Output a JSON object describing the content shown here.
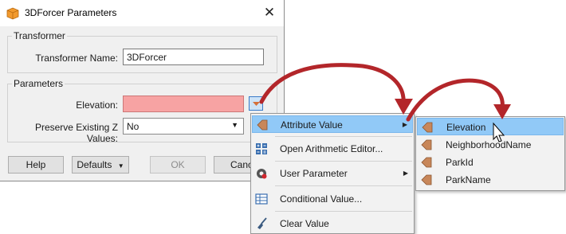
{
  "dialog": {
    "title": "3DForcer Parameters",
    "close_glyph": "✕",
    "transformer_group": {
      "label": "Transformer",
      "name_label": "Transformer Name:",
      "name_value": "3DForcer"
    },
    "parameters_group": {
      "label": "Parameters",
      "elevation_label": "Elevation:",
      "elevation_value": "",
      "preserve_label": "Preserve Existing Z Values:",
      "preserve_value": "No"
    },
    "buttons": {
      "help": "Help",
      "defaults": "Defaults",
      "ok": "OK",
      "cancel": "Cancel"
    }
  },
  "context_menu": {
    "items": [
      {
        "label": "Attribute Value",
        "icon": "attribute-arrow-icon",
        "has_submenu": true
      },
      {
        "label": "Open Arithmetic Editor...",
        "icon": "arithmetic-editor-icon",
        "has_submenu": false
      },
      {
        "label": "User Parameter",
        "icon": "user-parameter-gear-icon",
        "has_submenu": true
      },
      {
        "label": "Conditional Value...",
        "icon": "table-grid-icon",
        "has_submenu": false
      },
      {
        "label": "Clear Value",
        "icon": "broom-icon",
        "has_submenu": false
      }
    ]
  },
  "attribute_submenu": {
    "items": [
      {
        "label": "Elevation",
        "icon": "attribute-arrow-icon"
      },
      {
        "label": "NeighborhoodName",
        "icon": "attribute-arrow-icon"
      },
      {
        "label": "ParkId",
        "icon": "attribute-arrow-icon"
      },
      {
        "label": "ParkName",
        "icon": "attribute-arrow-icon"
      }
    ]
  },
  "colors": {
    "elevation_field_fill": "#f7a3a3",
    "menu_highlight": "#91c9f7",
    "annotation_arrow": "#b3262a",
    "attribute_icon": "#c8875a"
  }
}
